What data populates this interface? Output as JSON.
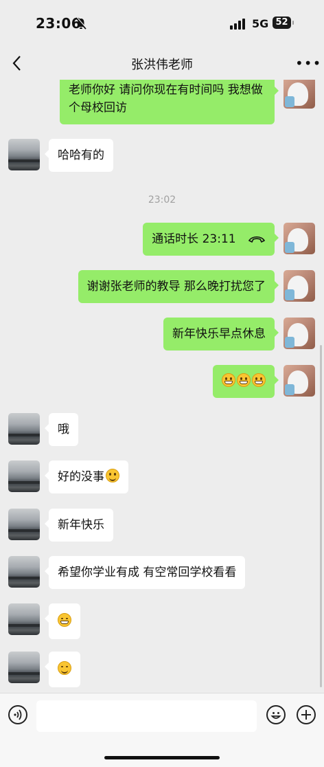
{
  "status": {
    "time": "23:06",
    "network": "5G",
    "battery": "52"
  },
  "header": {
    "title": "张洪伟老师",
    "more": "•••"
  },
  "messages": {
    "m0": "老师你好 请问你现在有时间吗 我想做个母校回访",
    "m1": "哈哈有的",
    "ts": "23:02",
    "m2": "通话时长 23:11",
    "m3": "谢谢张老师的教导 那么晚打扰您了",
    "m4": "新年快乐早点休息",
    "m6": "哦",
    "m7": "好的没事",
    "m8": "新年快乐",
    "m9": "希望你学业有成 有空常回学校看看"
  },
  "icons": {
    "m5": "grinning-emoji x3",
    "m7_emoji": "smile-emoji",
    "m10": "grinning-squint-emoji",
    "m11": "blush-emoji"
  },
  "input": {
    "placeholder": ""
  },
  "colors": {
    "background": "#ededed",
    "sent_bubble": "#95ec69",
    "received_bubble": "#ffffff"
  }
}
